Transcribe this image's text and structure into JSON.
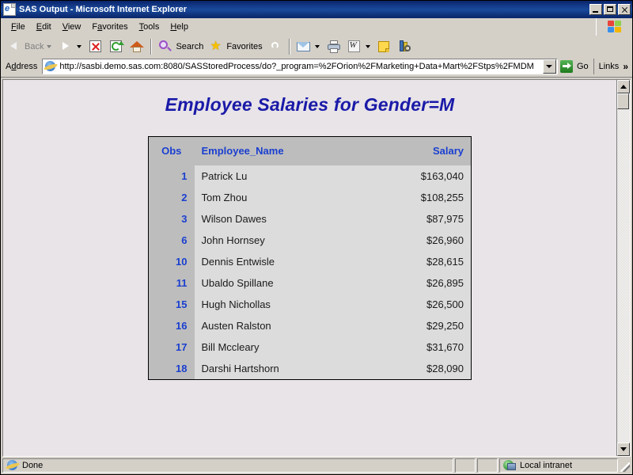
{
  "window": {
    "title": "SAS Output - Microsoft Internet Explorer",
    "icon": "ie-page-icon",
    "minimize_label": "Minimize",
    "maximize_label": "Maximize",
    "close_label": "Close"
  },
  "menu": {
    "items": [
      {
        "label": "File",
        "accel": "F"
      },
      {
        "label": "Edit",
        "accel": "E"
      },
      {
        "label": "View",
        "accel": "V"
      },
      {
        "label": "Favorites",
        "accel": "a"
      },
      {
        "label": "Tools",
        "accel": "T"
      },
      {
        "label": "Help",
        "accel": "H"
      }
    ],
    "brand_icon": "windows-flag-icon"
  },
  "toolbar": {
    "back_label": "Back",
    "back_icon": "back-arrow-icon",
    "forward_icon": "forward-arrow-icon",
    "stop_icon": "stop-icon",
    "refresh_icon": "refresh-icon",
    "home_icon": "home-icon",
    "search_label": "Search",
    "search_icon": "search-icon",
    "favorites_label": "Favorites",
    "favorites_icon": "star-icon",
    "history_icon": "history-icon",
    "mail_icon": "mail-icon",
    "print_icon": "print-icon",
    "edit_icon": "edit-icon",
    "messenger_icon": "notes-icon",
    "research_icon": "research-icon"
  },
  "address": {
    "label": "Address",
    "label_accel": "d",
    "icon": "ie-globe-icon",
    "url": "http://sasbi.demo.sas.com:8080/SASStoredProcess/do?_program=%2FOrion%2FMarketing+Data+Mart%2FStps%2FMDM",
    "dropdown_icon": "chevron-down-icon",
    "go_label": "Go",
    "go_icon": "go-arrow-icon",
    "links_label": "Links",
    "links_chevron": "»"
  },
  "page": {
    "heading": "Employee Salaries for Gender=M",
    "table": {
      "columns": [
        "Obs",
        "Employee_Name",
        "Salary"
      ],
      "rows": [
        {
          "obs": "1",
          "name": "Patrick Lu",
          "salary": "$163,040"
        },
        {
          "obs": "2",
          "name": "Tom Zhou",
          "salary": "$108,255"
        },
        {
          "obs": "3",
          "name": "Wilson Dawes",
          "salary": "$87,975"
        },
        {
          "obs": "6",
          "name": "John Hornsey",
          "salary": "$26,960"
        },
        {
          "obs": "10",
          "name": "Dennis Entwisle",
          "salary": "$28,615"
        },
        {
          "obs": "11",
          "name": "Ubaldo Spillane",
          "salary": "$26,895"
        },
        {
          "obs": "15",
          "name": "Hugh Nichollas",
          "salary": "$26,500"
        },
        {
          "obs": "16",
          "name": "Austen Ralston",
          "salary": "$29,250"
        },
        {
          "obs": "17",
          "name": "Bill Mccleary",
          "salary": "$31,670"
        },
        {
          "obs": "18",
          "name": "Darshi Hartshorn",
          "salary": "$28,090"
        }
      ]
    }
  },
  "scrollbar": {
    "up_icon": "scroll-up-icon",
    "down_icon": "scroll-down-icon"
  },
  "status": {
    "message": "Done",
    "message_icon": "ie-globe-icon",
    "zone": "Local intranet",
    "zone_icon": "local-intranet-icon"
  },
  "colors": {
    "titlebar": "#0a246a",
    "chrome": "#d4d0c8",
    "heading": "#1a1aa8",
    "table_header_text": "#1a3fd0",
    "table_header_bg": "#bdbdbd",
    "obs_cell_bg": "#bdbdbd",
    "data_cell_bg": "#dcdcdc",
    "page_bg": "#e8e4e8"
  }
}
